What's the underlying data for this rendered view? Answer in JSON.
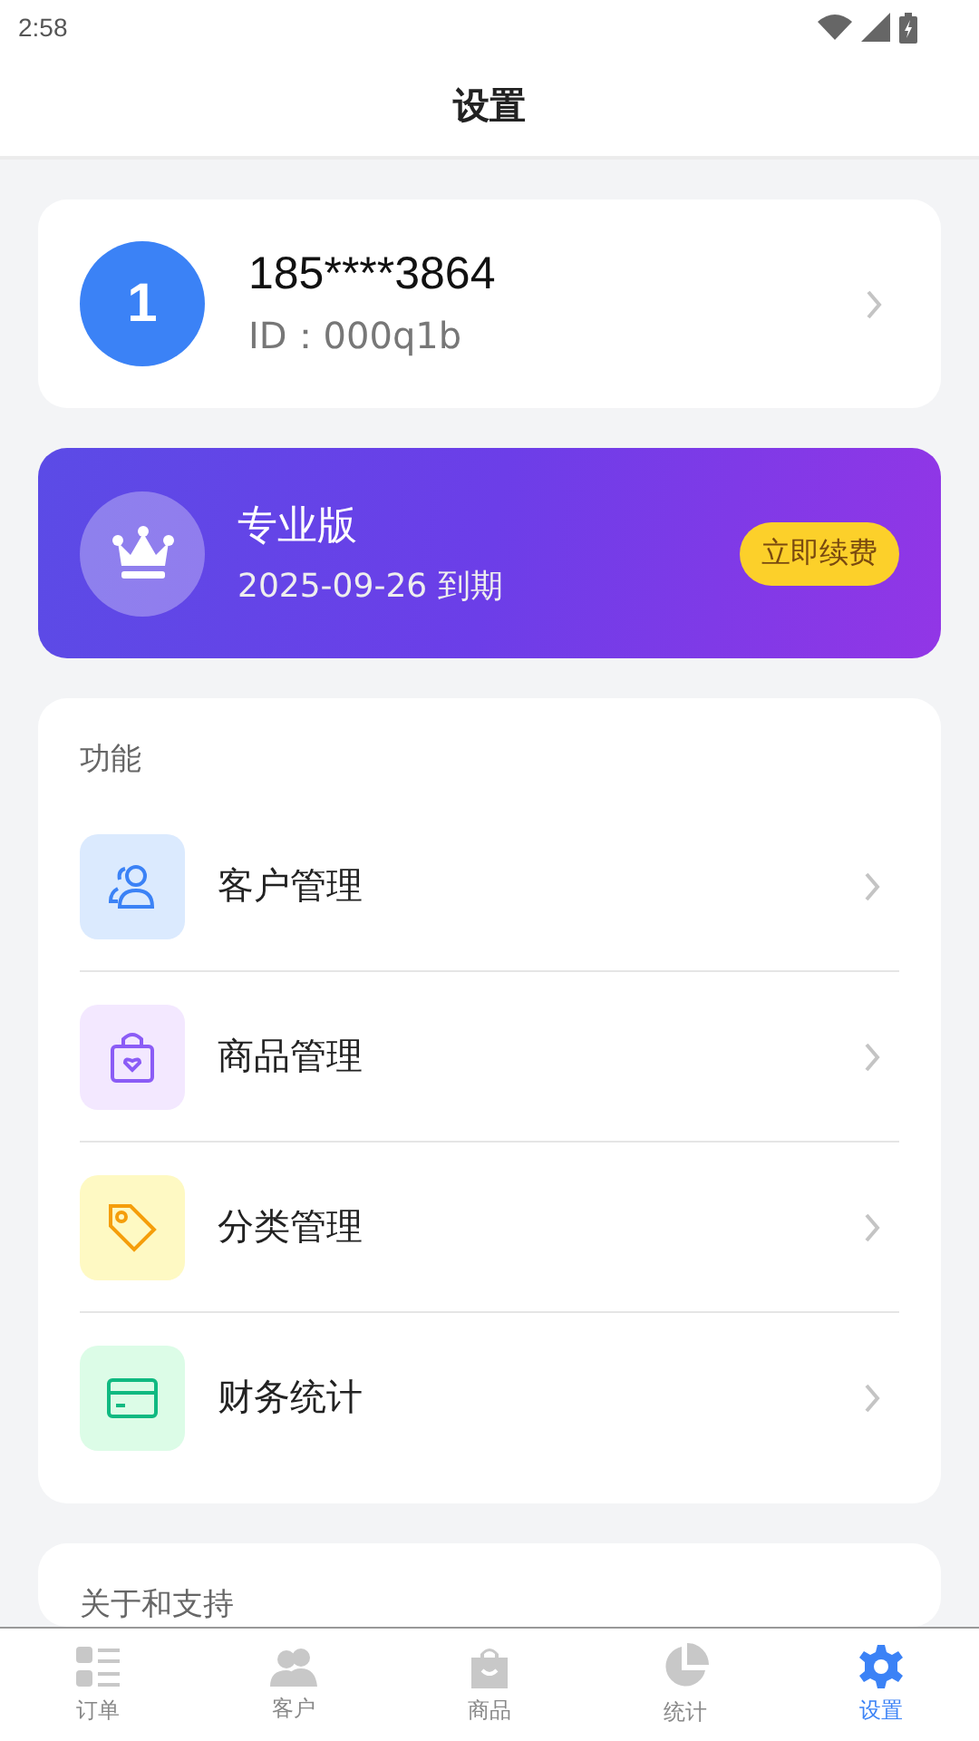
{
  "status_bar": {
    "time": "2:58"
  },
  "header": {
    "title": "设置"
  },
  "profile": {
    "avatar": "1",
    "phone": "185****3864",
    "id_text": "ID：000q1b"
  },
  "membership": {
    "plan": "专业版",
    "expiry": "2025-09-26 到期",
    "button": "立即续费"
  },
  "features": {
    "title": "功能",
    "items": [
      {
        "label": "客户管理",
        "kind": "customers",
        "color": "#3b82f6"
      },
      {
        "label": "商品管理",
        "kind": "products",
        "color": "#8b5cf6"
      },
      {
        "label": "分类管理",
        "kind": "categories",
        "color": "#f59e0b"
      },
      {
        "label": "财务统计",
        "kind": "finance",
        "color": "#10b981"
      }
    ]
  },
  "about": {
    "title": "关于和支持"
  },
  "tab_bar": [
    {
      "label": "订单",
      "kind": "orders",
      "selected": false
    },
    {
      "label": "客户",
      "kind": "customers",
      "selected": false
    },
    {
      "label": "商品",
      "kind": "products",
      "selected": false
    },
    {
      "label": "统计",
      "kind": "stats",
      "selected": false
    },
    {
      "label": "设置",
      "kind": "settings",
      "selected": true
    }
  ]
}
